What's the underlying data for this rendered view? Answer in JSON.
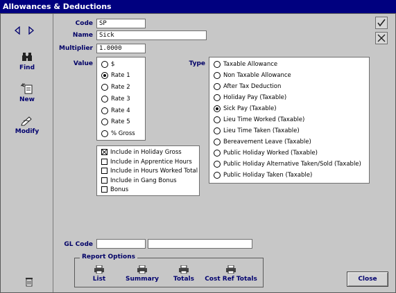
{
  "window": {
    "title": "Allowances & Deductions"
  },
  "sidebar": {
    "find_label": "Find",
    "new_label": "New",
    "modify_label": "Modify"
  },
  "form": {
    "code_label": "Code",
    "code_value": "SP",
    "name_label": "Name",
    "name_value": "Sick",
    "multiplier_label": "Multiplier",
    "multiplier_value": "1.0000",
    "value_label": "Value",
    "type_label": "Type",
    "gl_code_label": "GL Code",
    "gl_code_value": "",
    "gl_desc_value": ""
  },
  "value_options": [
    {
      "label": "$",
      "selected": false
    },
    {
      "label": "Rate 1",
      "selected": true
    },
    {
      "label": "Rate 2",
      "selected": false
    },
    {
      "label": "Rate 3",
      "selected": false
    },
    {
      "label": "Rate 4",
      "selected": false
    },
    {
      "label": "Rate 5",
      "selected": false
    },
    {
      "label": "% Gross",
      "selected": false
    }
  ],
  "type_options": [
    {
      "label": "Taxable Allowance",
      "selected": false
    },
    {
      "label": "Non Taxable Allowance",
      "selected": false
    },
    {
      "label": "After Tax Deduction",
      "selected": false
    },
    {
      "label": "Holiday Pay (Taxable)",
      "selected": false
    },
    {
      "label": "Sick Pay (Taxable)",
      "selected": true
    },
    {
      "label": "Lieu Time Worked (Taxable)",
      "selected": false
    },
    {
      "label": "Lieu Time Taken (Taxable)",
      "selected": false
    },
    {
      "label": "Bereavement Leave (Taxable)",
      "selected": false
    },
    {
      "label": "Public Holiday Worked (Taxable)",
      "selected": false
    },
    {
      "label": "Public Holiday Alternative Taken/Sold (Taxable)",
      "selected": false
    },
    {
      "label": "Public Holiday Taken (Taxable)",
      "selected": false
    }
  ],
  "checkboxes": [
    {
      "label": "Include in Holiday Gross",
      "checked": true
    },
    {
      "label": "Include in Apprentice Hours",
      "checked": false
    },
    {
      "label": "Include in Hours Worked Total",
      "checked": false
    },
    {
      "label": "Include in Gang Bonus",
      "checked": false
    },
    {
      "label": "Bonus",
      "checked": false
    }
  ],
  "report_options": {
    "title": "Report Options",
    "buttons": [
      "List",
      "Summary",
      "Totals",
      "Cost Ref Totals"
    ]
  },
  "close_label": "Close",
  "colors": {
    "titlebar": "#00007f",
    "label_text": "#000066",
    "background": "#c7c7c7"
  }
}
